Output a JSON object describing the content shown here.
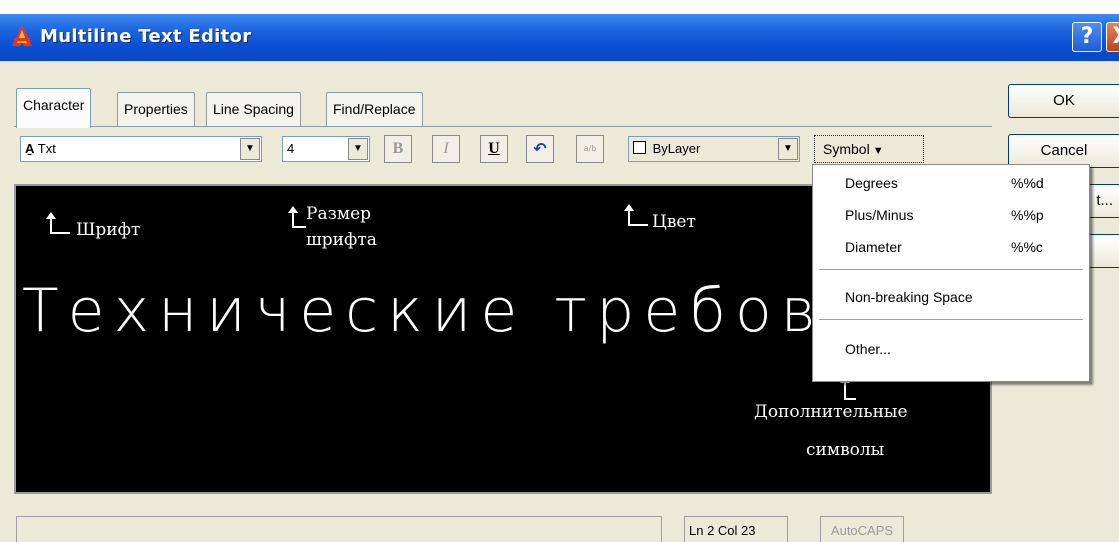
{
  "window": {
    "title": "Multiline Text Editor",
    "help_label": "?",
    "close_label": "X"
  },
  "tabs": [
    {
      "label": "Character",
      "active": true
    },
    {
      "label": "Properties",
      "active": false
    },
    {
      "label": "Line Spacing",
      "active": false
    },
    {
      "label": "Find/Replace",
      "active": false
    }
  ],
  "toolbar": {
    "font_value": "Txt",
    "height_value": "4",
    "bold_label": "B",
    "italic_label": "I",
    "underline_label": "U",
    "undo_label": "↶",
    "stack_label": "a/b",
    "color_value": "ByLayer",
    "symbol_label": "Symbol"
  },
  "side_buttons": {
    "ok_label": "OK",
    "cancel_label": "Cancel",
    "import_partial_label": "t..."
  },
  "editor": {
    "text": "Технические  требовани",
    "annotations": {
      "font": "Шрифт",
      "size_line1": "Размер",
      "size_line2": "шрифта",
      "color": "Цвет",
      "symbols_line1": "Дополнительные",
      "symbols_line2": "символы"
    }
  },
  "symbol_menu": {
    "items": [
      {
        "label": "Degrees",
        "code": "%%d"
      },
      {
        "label": "Plus/Minus",
        "code": "%%p"
      },
      {
        "label": "Diameter",
        "code": "%%c"
      }
    ],
    "nbsp_label": "Non-breaking Space",
    "other_label": "Other..."
  },
  "status": {
    "position": "Ln 2 Col 23",
    "caps": "AutoCAPS"
  },
  "colors": {
    "titlebar": "#0a4fd3",
    "dialog_bg": "#ece9d8",
    "editor_bg": "#000000"
  }
}
